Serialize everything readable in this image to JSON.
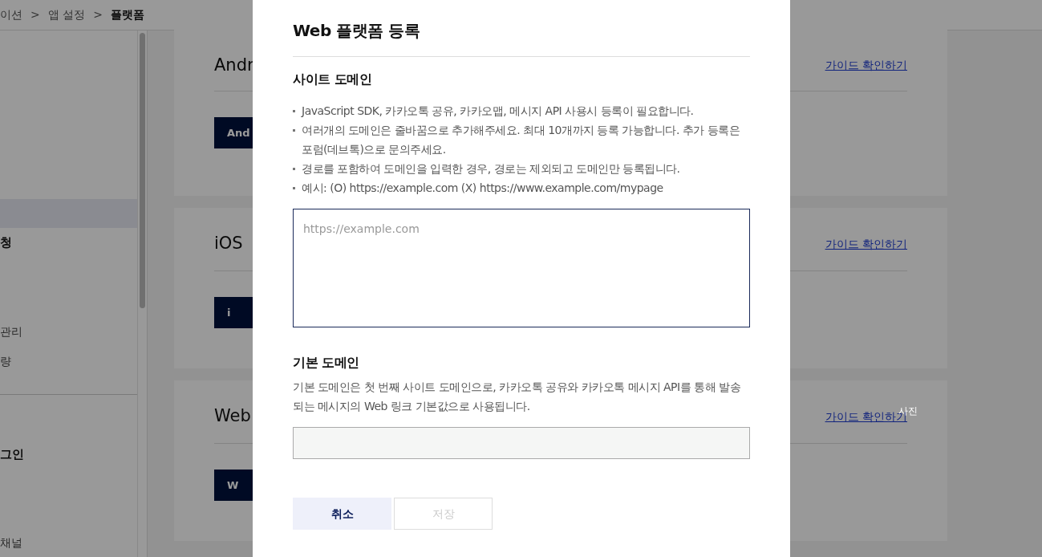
{
  "breadcrumb": [
    {
      "kind": "crumb",
      "text": "이션",
      "current": false
    },
    {
      "kind": "separator",
      "text": ">"
    },
    {
      "kind": "crumb",
      "text": "앱 설정",
      "current": false
    },
    {
      "kind": "separator",
      "text": ">"
    },
    {
      "kind": "crumb",
      "text": "플랫폼",
      "current": true
    }
  ],
  "sidebar": {
    "groups": [
      [
        {
          "kind": "item",
          "selected": true
        },
        {
          "kind": "category",
          "label": "청",
          "selected": false
        },
        {
          "kind": "item",
          "label": "관리",
          "selected": false
        },
        {
          "kind": "item",
          "label": "량",
          "selected": false
        }
      ],
      [
        {
          "kind": "category",
          "label": "그인",
          "selected": false
        },
        {
          "kind": "item",
          "label": "채널",
          "selected": false
        }
      ]
    ]
  },
  "platforms": [
    {
      "title": "Andr",
      "button": "And",
      "link": "가이드 확인하기"
    },
    {
      "title": "iOS",
      "button": "i",
      "link": "가이드 확인하기"
    },
    {
      "title": "Web",
      "button": "W",
      "link": "가이드 확인하기"
    }
  ],
  "overlay_label": "사진",
  "modal": {
    "title": "Web 플랫폼 등록",
    "site_domain": {
      "heading": "사이트 도메인",
      "notes": [
        "JavaScript SDK, 카카오톡 공유, 카카오맵, 메시지 API 사용시 등록이 필요합니다.",
        "여러개의 도메인은 줄바꿈으로 추가해주세요. 최대 10개까지 등록 가능합니다. 추가 등록은 포럼(데브톡)으로 문의주세요.",
        "경로를 포함하여 도메인을 입력한 경우, 경로는 제외되고 도메인만 등록됩니다.",
        "예시: (O) https://example.com (X) https://www.example.com/mypage"
      ],
      "placeholder": "https://example.com"
    },
    "default_domain": {
      "heading": "기본 도메인",
      "description": "기본 도메인은 첫 번째 사이트 도메인으로, 카카오톡 공유와 카카오톡 메시지 API를 통해 발송되는 메시지의 Web 링크 기본값으로 사용됩니다.",
      "disabled": true
    },
    "buttons": [
      {
        "label": "취소",
        "kind": "cancel",
        "disabled": false
      },
      {
        "label": "저장",
        "kind": "save",
        "disabled": true
      }
    ]
  }
}
